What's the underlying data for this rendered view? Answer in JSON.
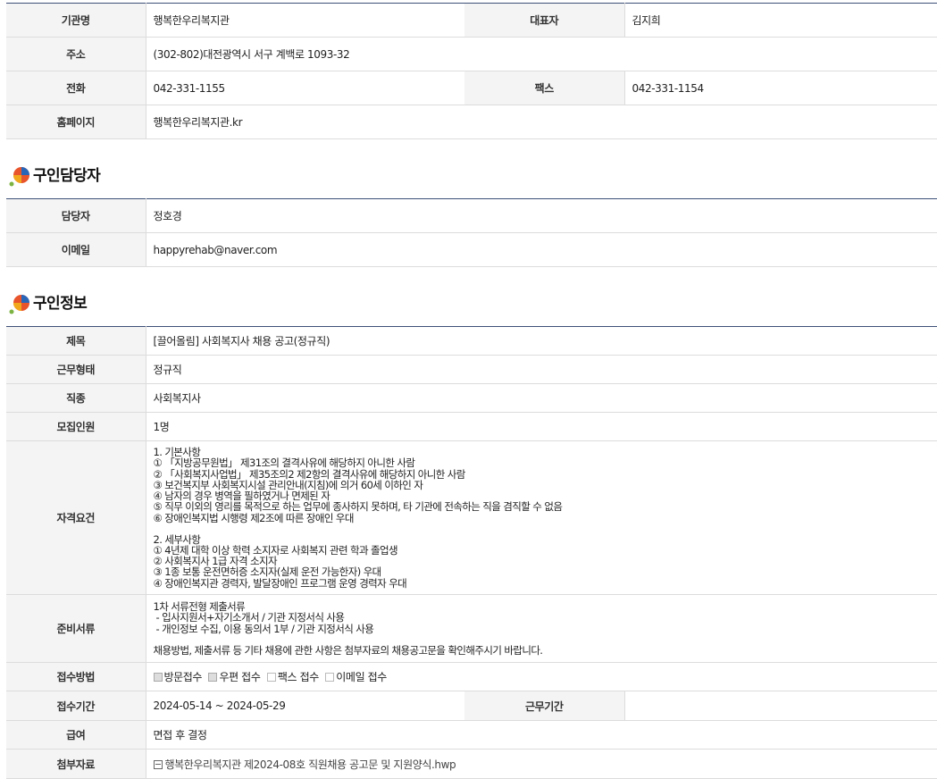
{
  "org": {
    "name_label": "기관명",
    "name": "행복한우리복지관",
    "rep_label": "대표자",
    "rep": "김지희",
    "address_label": "주소",
    "address": "(302-802)대전광역시 서구 계백로 1093-32",
    "phone_label": "전화",
    "phone": "042-331-1155",
    "fax_label": "팩스",
    "fax": "042-331-1154",
    "homepage_label": "홈페이지",
    "homepage": "행복한우리복지관.kr"
  },
  "contact": {
    "title": "구인담당자",
    "manager_label": "담당자",
    "manager": "정호경",
    "email_label": "이메일",
    "email": "happyrehab@naver.com"
  },
  "job": {
    "title": "구인정보",
    "subject_label": "제목",
    "subject": "[끌어올림] 사회복지사 채용 공고(정규직)",
    "type_label": "근무형태",
    "type": "정규직",
    "category_label": "직종",
    "category": "사회복지사",
    "headcount_label": "모집인원",
    "headcount": "1명",
    "qual_label": "자격요건",
    "qual_lines": [
      "1. 기본사항",
      "① 「지방공무원법」 제31조의 결격사유에 해당하지 아니한 사람",
      "② 「사회복지사업법」 제35조의2 제2항의 결격사유에 해당하지 아니한 사람",
      "③ 보건복지부 사회복지시설 관리안내(지침)에 의거 60세 이하인 자",
      "④ 남자의 경우 병역을 필하였거나 면제된 자",
      "⑤ 직무 이외의 영리를 목적으로 하는 업무에 종사하지 못하며, 타 기관에 전속하는 직을 겸직할 수 없음",
      "⑥ 장애인복지법 시행령 제2조에 따른 장애인 우대",
      "",
      "2. 세부사항",
      "① 4년제 대학 이상 학력 소지자로 사회복지 관련 학과 졸업생",
      "② 사회복지사 1급 자격 소지자",
      "③ 1종 보통 운전면허증 소지자(실제 운전 가능한자) 우대",
      "④ 장애인복지관 경력자, 발달장애인 프로그램 운영 경력자 우대"
    ],
    "docs_label": "준비서류",
    "docs_lines": [
      "1차 서류전형 제출서류",
      " - 입사지원서+자기소개서 / 기관 지정서식 사용",
      " - 개인정보 수집, 이용 동의서 1부 / 기관 지정서식 사용",
      "",
      "채용방법, 제출서류 등 기타 채용에 관한 사항은 첨부자료의 채용공고문을 확인해주시기 바랍니다."
    ],
    "method_label": "접수방법",
    "methods": [
      {
        "label": "방문접수",
        "checked": true
      },
      {
        "label": "우편 접수",
        "checked": true
      },
      {
        "label": "팩스 접수",
        "checked": false
      },
      {
        "label": "이메일 접수",
        "checked": false
      }
    ],
    "period_label": "접수기간",
    "period": "2024-05-14 ~ 2024-05-29",
    "work_period_label": "근무기간",
    "work_period": "",
    "salary_label": "급여",
    "salary": "면접 후 결정",
    "attach_label": "첨부자료",
    "attach": "행복한우리복지관 제2024-08호 직원채용 공고문 및 지원양식.hwp"
  }
}
